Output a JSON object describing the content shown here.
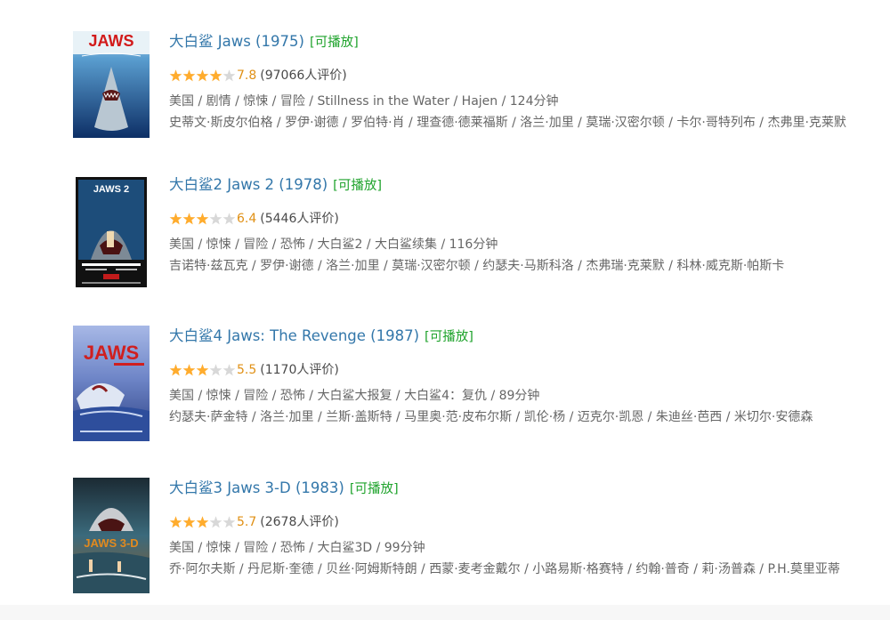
{
  "results": [
    {
      "title": "大白鲨 Jaws (1975)",
      "playable_label": "[可播放]",
      "star_count": 4,
      "rating": "7.8",
      "votes": "(97066人评价)",
      "meta": "美国 / 剧情 / 惊悚 / 冒险 / Stillness in the Water / Hajen / 124分钟",
      "cast": "史蒂文·斯皮尔伯格 / 罗伊·谢德 / 罗伯特·肖 / 理查德·德莱福斯 / 洛兰·加里 / 莫瑞·汉密尔顿 / 卡尔·哥特列布 / 杰弗里·克莱默",
      "poster_text": "JAWS"
    },
    {
      "title": "大白鲨2 Jaws 2 (1978)",
      "playable_label": "[可播放]",
      "star_count": 3,
      "rating": "6.4",
      "votes": "(5446人评价)",
      "meta": "美国 / 惊悚 / 冒险 / 恐怖 / 大白鲨2 / 大白鲨续集 / 116分钟",
      "cast": "吉诺特·兹瓦克 / 罗伊·谢德 / 洛兰·加里 / 莫瑞·汉密尔顿 / 约瑟夫·马斯科洛 / 杰弗瑞·克莱默 / 科林·威克斯·帕斯卡",
      "poster_text": "JAWS 2"
    },
    {
      "title": "大白鲨4 Jaws: The Revenge (1987)",
      "playable_label": "[可播放]",
      "star_count": 3,
      "rating": "5.5",
      "votes": "(1170人评价)",
      "meta": "美国 / 惊悚 / 冒险 / 恐怖 / 大白鲨大报复 / 大白鲨4：复仇 / 89分钟",
      "cast": "约瑟夫·萨金特 / 洛兰·加里 / 兰斯·盖斯特 / 马里奥·范·皮布尔斯 / 凯伦·杨 / 迈克尔·凯恩 / 朱迪丝·芭西 / 米切尔·安德森",
      "poster_text": "JAWS"
    },
    {
      "title": "大白鲨3 Jaws 3-D (1983)",
      "playable_label": "[可播放]",
      "star_count": 3,
      "rating": "5.7",
      "votes": "(2678人评价)",
      "meta": "美国 / 惊悚 / 冒险 / 恐怖 / 大白鲨3D / 99分钟",
      "cast": "乔·阿尔夫斯 / 丹尼斯·奎德 / 贝丝·阿姆斯特朗 / 西蒙·麦考金戴尔 / 小路易斯·格赛特 / 约翰·普奇 / 莉·汤普森 / P.H.莫里亚蒂",
      "poster_text": "JAWS 3-D"
    }
  ],
  "colors": {
    "title_link": "#3377aa",
    "playable": "#1fa32c",
    "score": "#e09015",
    "star_on": "#ffac2d",
    "star_off": "#d8d8d8",
    "meta_text": "#666666"
  }
}
